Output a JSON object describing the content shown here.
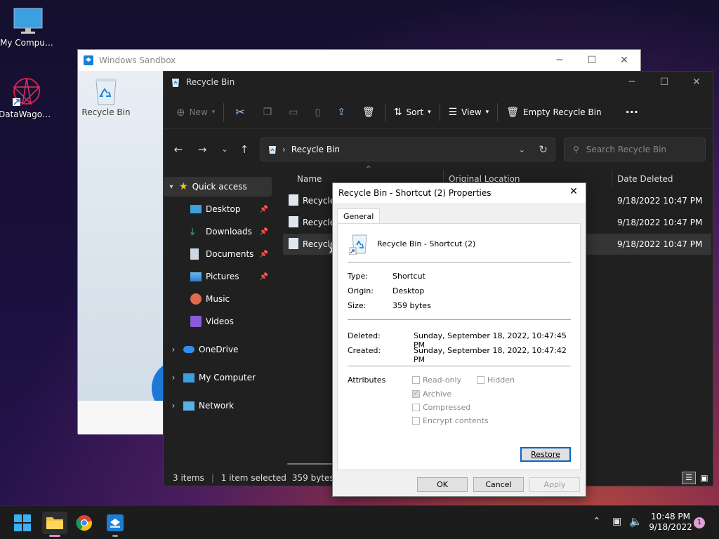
{
  "desktop": {
    "icons": [
      {
        "label": "My Computer"
      },
      {
        "label": "DataWagon..."
      },
      {
        "label": "Recycle Bin"
      }
    ]
  },
  "sandbox": {
    "title": "Windows Sandbox"
  },
  "explorer": {
    "title": "Recycle Bin",
    "toolbar": {
      "new_label": "New",
      "sort_label": "Sort",
      "view_label": "View",
      "empty_label": "Empty Recycle Bin",
      "more_label": "···"
    },
    "address": {
      "crumb": "Recycle Bin"
    },
    "search": {
      "placeholder": "Search Recycle Bin"
    },
    "sidebar": [
      {
        "label": "Quick access"
      },
      {
        "label": "Desktop"
      },
      {
        "label": "Downloads"
      },
      {
        "label": "Documents"
      },
      {
        "label": "Pictures"
      },
      {
        "label": "Music"
      },
      {
        "label": "Videos"
      },
      {
        "label": "OneDrive"
      },
      {
        "label": "My Computer"
      },
      {
        "label": "Network"
      }
    ],
    "columns": {
      "name": "Name",
      "origin": "Original Location",
      "deleted": "Date Deleted"
    },
    "rows": [
      {
        "name": "Recycle",
        "deleted": "9/18/2022 10:47 PM"
      },
      {
        "name": "Recycle",
        "deleted": "9/18/2022 10:47 PM"
      },
      {
        "name": "Recycle",
        "deleted": "9/18/2022 10:47 PM"
      }
    ],
    "status": {
      "items": "3 items",
      "selected": "1 item selected",
      "size": "359 bytes"
    }
  },
  "dialog": {
    "title": "Recycle Bin - Shortcut (2) Properties",
    "tab": "General",
    "filename": "Recycle Bin - Shortcut (2)",
    "type_label": "Type:",
    "type_value": "Shortcut",
    "origin_label": "Origin:",
    "origin_value": "Desktop",
    "size_label": "Size:",
    "size_value": "359 bytes",
    "deleted_label": "Deleted:",
    "deleted_value": "Sunday, September 18, 2022, 10:47:45 PM",
    "created_label": "Created:",
    "created_value": "Sunday, September 18, 2022, 10:47:42 PM",
    "attributes_label": "Attributes",
    "attributes": {
      "readonly": "Read-only",
      "hidden": "Hidden",
      "archive": "Archive",
      "compressed": "Compressed",
      "encrypt": "Encrypt contents"
    },
    "restore_label": "Restore",
    "ok_label": "OK",
    "cancel_label": "Cancel",
    "apply_label": "Apply"
  },
  "taskbar": {
    "time": "10:48 PM",
    "date": "9/18/2022",
    "notification_count": "1"
  }
}
